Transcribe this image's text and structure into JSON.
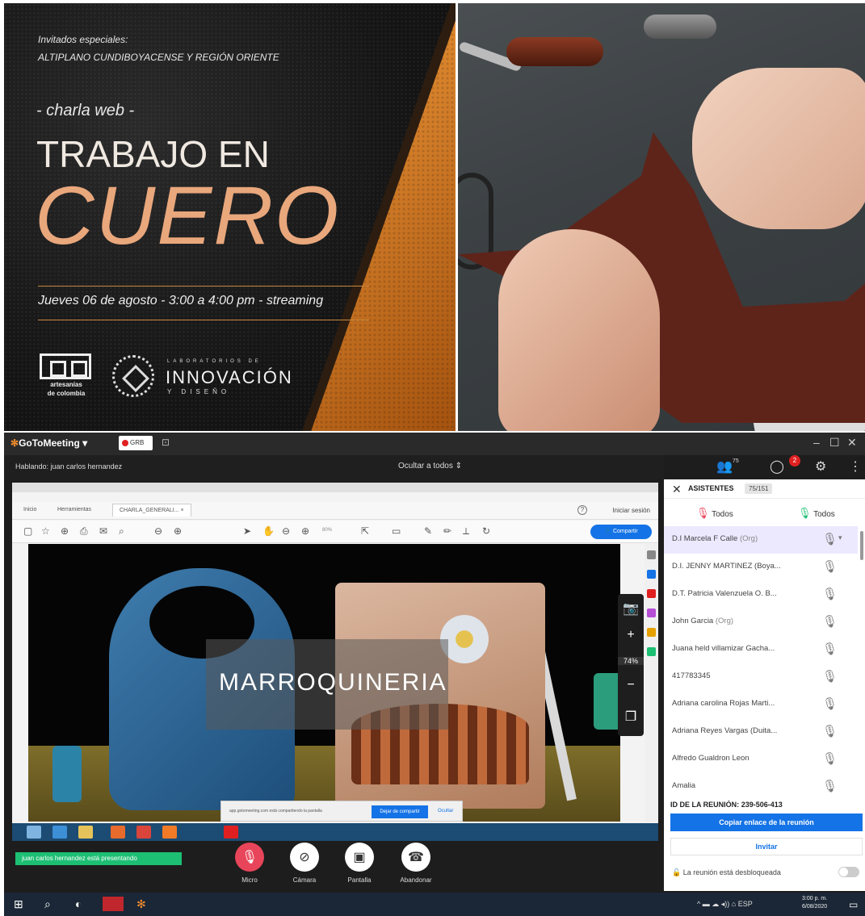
{
  "poster": {
    "invitados": "Invitados especiales:",
    "region": "ALTIPLANO CUNDIBOYACENSE Y REGIÓN ORIENTE",
    "charla": "- charla web -",
    "title_line1": "TRABAJO EN",
    "title_line2": "CUERO",
    "date": "Jueves 06 de agosto - 3:00 a 4:00 pm - streaming",
    "logo1_text1": "artesanías",
    "logo1_text2": "de colombia",
    "logo2_lab": "LABORATORIOS DE",
    "logo2_main": "INNOVACIÓN",
    "logo2_sub": "Y DISEÑO",
    "colors": {
      "accent": "#e9a77c",
      "orange": "#d97c25"
    }
  },
  "gtm": {
    "app_name": "GoToMeeting",
    "rec_label": "GRB",
    "speaking": "Hablando: juan carlos hernandez",
    "ocultar": "Ocultar a todos",
    "attendee_count": "75",
    "chat_badge": "2",
    "presenting": "juan carlos hernandez está presentando",
    "marroquineria": "MARROQUINERIA",
    "zoom_pct": "74%",
    "share_message": "app.gotomeeting.com está compartiendo la pantalla",
    "share_stop": "Dejar de compartir",
    "share_hide": "Ocultar",
    "acrobat": {
      "tab_inicio": "Inicio",
      "tab_herramientas": "Herramientas",
      "tab_doc": "CHARLA_GENERALI... ×",
      "login": "Iniciar sesión",
      "share": "Compartir",
      "zoom_field": "80%"
    },
    "controls": [
      {
        "label": "Micro",
        "icon": "mic-muted-icon"
      },
      {
        "label": "Cámara",
        "icon": "camera-off-icon"
      },
      {
        "label": "Pantalla",
        "icon": "screen-icon"
      },
      {
        "label": "Abandonar",
        "icon": "phone-hangup-icon"
      }
    ]
  },
  "panel": {
    "title": "ASISTENTES",
    "count": "75/151",
    "todos_mute": "Todos",
    "todos_unmute": "Todos",
    "attendees": [
      {
        "name": "D.I Marcela F Calle",
        "tag": "(Org)"
      },
      {
        "name": "D.I. JENNY MARTINEZ (Boya...",
        "tag": ""
      },
      {
        "name": "D.T. Patricia Valenzuela O. B...",
        "tag": ""
      },
      {
        "name": "John Garcia",
        "tag": "(Org)"
      },
      {
        "name": "Juana held villamizar Gacha...",
        "tag": ""
      },
      {
        "name": "417783345",
        "tag": ""
      },
      {
        "name": "Adriana carolina Rojas Marti...",
        "tag": ""
      },
      {
        "name": "Adriana Reyes Vargas (Duita...",
        "tag": ""
      },
      {
        "name": "Alfredo Gualdron Leon",
        "tag": ""
      },
      {
        "name": "Amalia",
        "tag": ""
      }
    ],
    "meeting_id_label": "ID DE LA REUNIÓN:",
    "meeting_id": "239-506-413",
    "copy_link": "Copiar enlace de la reunión",
    "invite": "Invitar",
    "unlocked": "La reunión está desbloqueada"
  },
  "taskbar": {
    "lang": "ESP",
    "time": "3:00 p. m.",
    "date": "6/08/2020"
  }
}
